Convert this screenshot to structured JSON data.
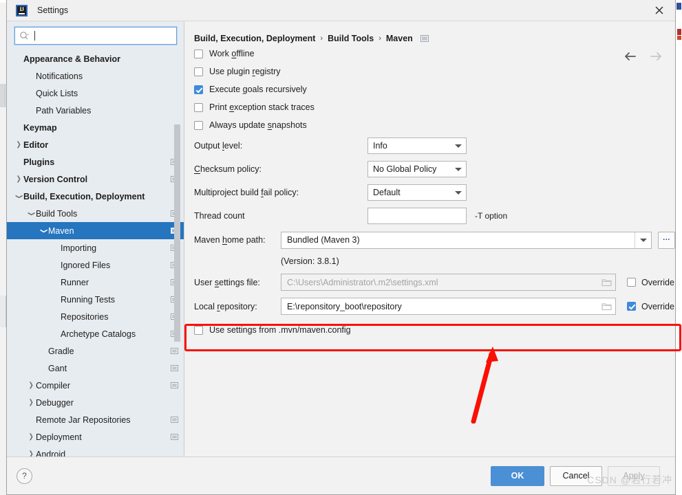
{
  "window": {
    "title": "Settings",
    "logo_text": "IJ",
    "close_icon": "close-icon"
  },
  "sidebar": {
    "search": {
      "value": "",
      "placeholder": "",
      "icon": "search-icon"
    },
    "items": [
      {
        "label": "Appearance & Behavior",
        "indent": 0,
        "bold": true,
        "arrow": "none",
        "scope": false,
        "selected": false
      },
      {
        "label": "Notifications",
        "indent": 1,
        "bold": false,
        "arrow": "none",
        "scope": false,
        "selected": false
      },
      {
        "label": "Quick Lists",
        "indent": 1,
        "bold": false,
        "arrow": "none",
        "scope": false,
        "selected": false
      },
      {
        "label": "Path Variables",
        "indent": 1,
        "bold": false,
        "arrow": "none",
        "scope": false,
        "selected": false
      },
      {
        "label": "Keymap",
        "indent": 0,
        "bold": true,
        "arrow": "none",
        "scope": false,
        "selected": false
      },
      {
        "label": "Editor",
        "indent": 0,
        "bold": true,
        "arrow": "right",
        "scope": false,
        "selected": false
      },
      {
        "label": "Plugins",
        "indent": 0,
        "bold": true,
        "arrow": "none",
        "scope": true,
        "selected": false
      },
      {
        "label": "Version Control",
        "indent": 0,
        "bold": true,
        "arrow": "right",
        "scope": true,
        "selected": false
      },
      {
        "label": "Build, Execution, Deployment",
        "indent": 0,
        "bold": true,
        "arrow": "down",
        "scope": false,
        "selected": false
      },
      {
        "label": "Build Tools",
        "indent": 1,
        "bold": false,
        "arrow": "down",
        "scope": true,
        "selected": false
      },
      {
        "label": "Maven",
        "indent": 2,
        "bold": false,
        "arrow": "down",
        "scope": true,
        "selected": true
      },
      {
        "label": "Importing",
        "indent": 3,
        "bold": false,
        "arrow": "none",
        "scope": true,
        "selected": false
      },
      {
        "label": "Ignored Files",
        "indent": 3,
        "bold": false,
        "arrow": "none",
        "scope": true,
        "selected": false
      },
      {
        "label": "Runner",
        "indent": 3,
        "bold": false,
        "arrow": "none",
        "scope": true,
        "selected": false
      },
      {
        "label": "Running Tests",
        "indent": 3,
        "bold": false,
        "arrow": "none",
        "scope": true,
        "selected": false
      },
      {
        "label": "Repositories",
        "indent": 3,
        "bold": false,
        "arrow": "none",
        "scope": true,
        "selected": false
      },
      {
        "label": "Archetype Catalogs",
        "indent": 3,
        "bold": false,
        "arrow": "none",
        "scope": true,
        "selected": false
      },
      {
        "label": "Gradle",
        "indent": 2,
        "bold": false,
        "arrow": "none",
        "scope": true,
        "selected": false
      },
      {
        "label": "Gant",
        "indent": 2,
        "bold": false,
        "arrow": "none",
        "scope": true,
        "selected": false
      },
      {
        "label": "Compiler",
        "indent": 1,
        "bold": false,
        "arrow": "right",
        "scope": true,
        "selected": false
      },
      {
        "label": "Debugger",
        "indent": 1,
        "bold": false,
        "arrow": "right",
        "scope": false,
        "selected": false
      },
      {
        "label": "Remote Jar Repositories",
        "indent": 1,
        "bold": false,
        "arrow": "none",
        "scope": true,
        "selected": false
      },
      {
        "label": "Deployment",
        "indent": 1,
        "bold": false,
        "arrow": "right",
        "scope": true,
        "selected": false
      },
      {
        "label": "Android",
        "indent": 1,
        "bold": false,
        "arrow": "right",
        "scope": false,
        "selected": false
      }
    ]
  },
  "main": {
    "breadcrumb": {
      "part1": "Build, Execution, Deployment",
      "sep1": "›",
      "part2": "Build Tools",
      "sep2": "›",
      "part3": "Maven",
      "scope_icon": "project-scope-icon"
    },
    "nav": {
      "back_icon": "arrow-left-icon",
      "forward_icon": "arrow-right-icon"
    },
    "checkboxes": [
      {
        "pre": "Work ",
        "mn": "o",
        "post": "ffline",
        "checked": false
      },
      {
        "pre": "Use plugin ",
        "mn": "r",
        "post": "egistry",
        "checked": false
      },
      {
        "pre": "Execute ",
        "mn": "g",
        "post": "oals recursively",
        "checked": true
      },
      {
        "pre": "Print ",
        "mn": "e",
        "post": "xception stack traces",
        "checked": false
      },
      {
        "pre": "Always update ",
        "mn": "s",
        "post": "napshots",
        "checked": false
      }
    ],
    "output_level": {
      "pre": "Output ",
      "mn": "l",
      "post": "evel:",
      "value": "Info"
    },
    "checksum": {
      "pre": "",
      "mn": "C",
      "post": "hecksum policy:",
      "value": "No Global Policy"
    },
    "multiproject": {
      "pre": "Multiproject build ",
      "mn": "f",
      "post": "ail policy:",
      "value": "Default"
    },
    "thread_count": {
      "label": "Thread count",
      "value": "",
      "note": "-T option"
    },
    "maven_home": {
      "pre": "Maven ",
      "mn": "h",
      "post": "ome path:",
      "value": "Bundled (Maven 3)",
      "browse_label": "...",
      "version": "(Version: 3.8.1)"
    },
    "user_settings": {
      "pre": "User ",
      "mn": "s",
      "post": "ettings file:",
      "value": "C:\\Users\\Administrator\\.m2\\settings.xml",
      "is_placeholder": true,
      "override_label": "Override",
      "override_checked": false,
      "folder_icon": "folder-icon"
    },
    "local_repository": {
      "pre": "Local ",
      "mn": "r",
      "post": "epository:",
      "value": "E:\\reponsitory_boot\\repository",
      "is_placeholder": false,
      "override_label": "Override",
      "override_checked": true,
      "folder_icon": "folder-icon"
    },
    "mvn_config": {
      "label": "Use settings from .mvn/maven.config",
      "checked": false
    }
  },
  "footer": {
    "help_label": "?",
    "ok_label": "OK",
    "cancel_label": "Cancel",
    "apply_label": "Apply"
  },
  "watermark": "CSDN @若行若冲",
  "annotation": {
    "box_color": "#fa1005",
    "arrow_color": "#fa1005"
  },
  "colors": {
    "accent_blue": "#2675bf",
    "checkbox_blue": "#3e8adc",
    "ok_button": "#4b8fd4",
    "sidebar_bg": "#e7ecf0",
    "panel_bg": "#f2f2f2"
  }
}
